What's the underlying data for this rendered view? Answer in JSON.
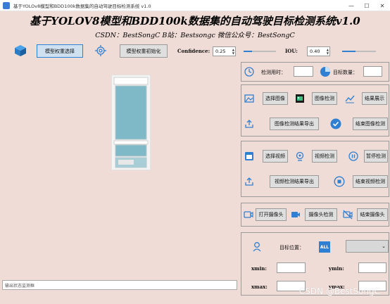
{
  "window": {
    "title": "基于YOLOv8模型和BDD100k数据集的自动驾驶目标检测系统 v1.0",
    "minimize": "—",
    "maximize": "☐",
    "close": "✕"
  },
  "header": {
    "title": "基于YOLOV8模型和BDD100k数据集的自动驾驶目标检测系统v1.0",
    "subtitle": "CSDN：BestSongC   B站：Bestsongc   微信公众号：BestSongC"
  },
  "toolbar": {
    "select_weights": "模型权重选择",
    "init_weights": "模型权重初始化",
    "confidence_label": "Confidence:",
    "confidence_value": "0.25",
    "confidence_level": 0.25,
    "iou_label": "IOU:",
    "iou_value": "0.40",
    "iou_level": 0.4
  },
  "status_bar": {
    "text": "输出状态监测框"
  },
  "stats": {
    "time_label": "检测用时：",
    "time_value": "",
    "count_label": "目标数量：",
    "count_value": ""
  },
  "image_section": {
    "select": "选择图像",
    "detect": "图像检测",
    "show_result": "结果展示",
    "export": "图像检测结果导出",
    "end": "结束图像检测"
  },
  "video_section": {
    "select": "选择视频",
    "detect": "视频检测",
    "pause": "暂停检测",
    "export": "视频检测结果导出",
    "end": "结束视频检测"
  },
  "camera_section": {
    "open": "打开摄像头",
    "detect": "摄像头检测",
    "end": "结束摄像头"
  },
  "target_section": {
    "position_label": "目标位置：",
    "all_icon_text": "ALL",
    "selected": "",
    "xmin_label": "xmin:",
    "ymin_label": "ymin:",
    "xmax_label": "xmax:",
    "ymax_label": "ymax:",
    "xmin": "",
    "ymin": "",
    "xmax": "",
    "ymax": ""
  },
  "watermark": "CSDN @BestSongC",
  "colors": {
    "background": "#f0dcd6",
    "accent": "#2f7fd2",
    "button": "#dfdfdf"
  }
}
